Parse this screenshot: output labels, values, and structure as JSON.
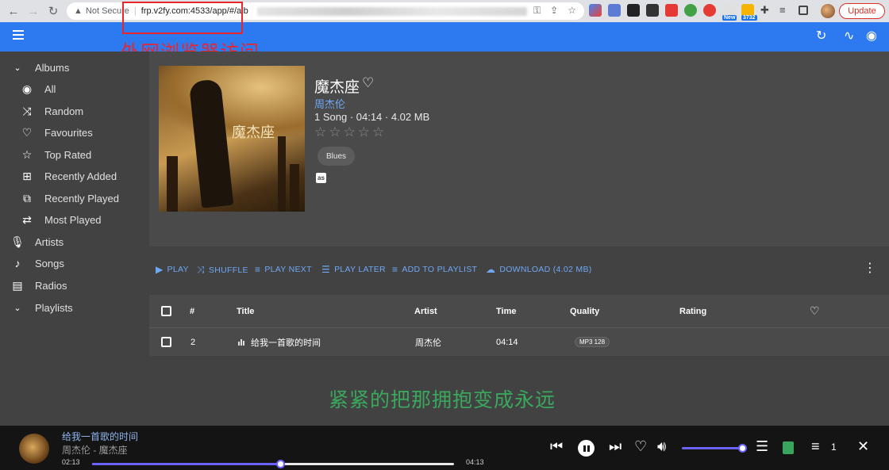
{
  "browser": {
    "back_icon": "arrow-left-icon",
    "forward_icon": "arrow-right-icon",
    "reload_icon": "reload-icon",
    "security_label": "Not Secure",
    "url": "frp.v2fy.com:4533/app/#/alb",
    "update_label": "Update",
    "extension_badges": [
      "New",
      "3732"
    ]
  },
  "annotation": {
    "label": "外网浏览器访问",
    "color": "#e8262b"
  },
  "appbar": {
    "color": "#2d7af0"
  },
  "sidebar": {
    "albums_label": "Albums",
    "album_items": [
      {
        "label": "All",
        "icon": "radio-dot-icon"
      },
      {
        "label": "Random",
        "icon": "shuffle-icon"
      },
      {
        "label": "Favourites",
        "icon": "heart-outline-icon"
      },
      {
        "label": "Top Rated",
        "icon": "star-outline-icon"
      },
      {
        "label": "Recently Added",
        "icon": "library-add-icon"
      },
      {
        "label": "Recently Played",
        "icon": "library-play-icon"
      },
      {
        "label": "Most Played",
        "icon": "repeat-icon"
      }
    ],
    "sections": [
      {
        "label": "Artists",
        "icon": "microphone-icon"
      },
      {
        "label": "Songs",
        "icon": "music-note-icon"
      },
      {
        "label": "Radios",
        "icon": "radio-icon"
      }
    ],
    "playlists_label": "Playlists"
  },
  "album": {
    "cover_title": "魔杰座",
    "title": "魔杰座",
    "artist": "周杰伦",
    "meta": "1 Song · 04:14 · 4.02 MB",
    "rating": 0,
    "rating_max": 5,
    "genre": "Blues",
    "lastfm_label": "as"
  },
  "actions": {
    "play": "PLAY",
    "shuffle": "SHUFFLE",
    "play_next": "PLAY NEXT",
    "play_later": "PLAY LATER",
    "add_to_playlist": "ADD TO PLAYLIST",
    "download": "DOWNLOAD (4.02 MB)"
  },
  "table": {
    "headers": {
      "number": "#",
      "title": "Title",
      "artist": "Artist",
      "time": "Time",
      "quality": "Quality",
      "rating": "Rating"
    },
    "rows": [
      {
        "number": "2",
        "title": "给我一首歌的时间",
        "artist": "周杰伦",
        "time": "04:14",
        "quality": "MP3 128"
      }
    ]
  },
  "lyric": {
    "text": "紧紧的把那拥抱变成永远",
    "color": "#39a85d"
  },
  "player": {
    "title": "给我一首歌的时间",
    "subtitle": "周杰伦 - 魔杰座",
    "current_time": "02:13",
    "duration": "04:13",
    "progress": 0.52,
    "volume": 1.0,
    "queue_count": "1",
    "accent": "#6c63ff"
  }
}
